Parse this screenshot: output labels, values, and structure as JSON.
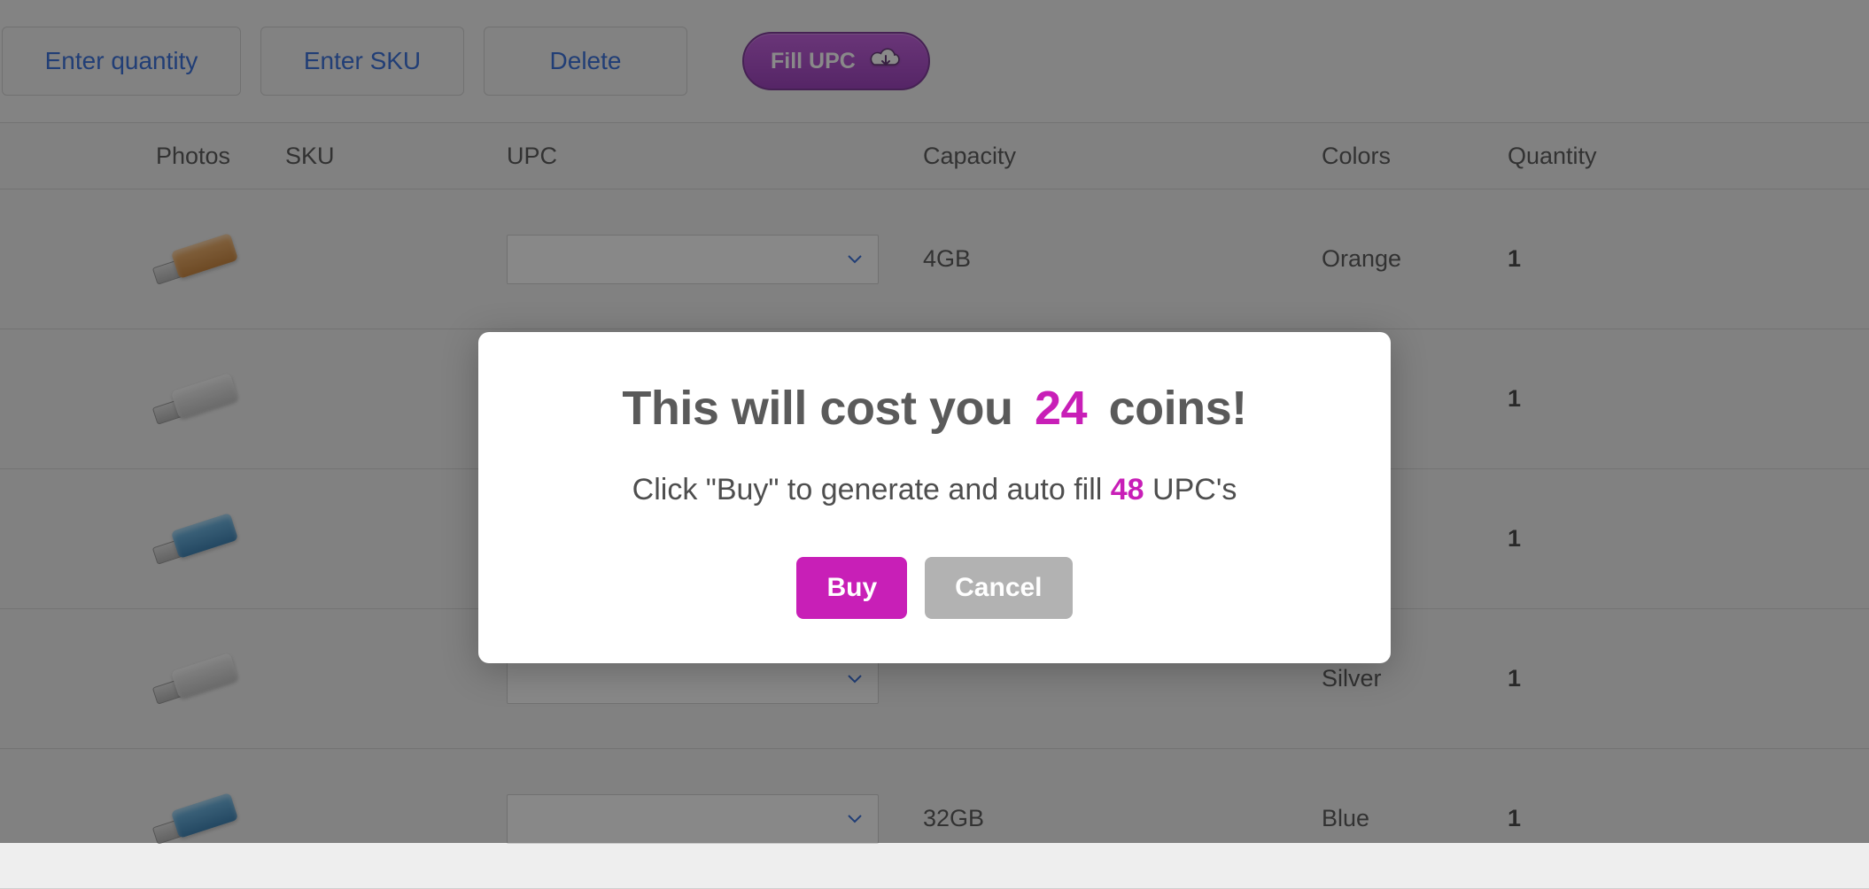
{
  "toolbar": {
    "enter_quantity": "Enter quantity",
    "enter_sku": "Enter SKU",
    "delete": "Delete",
    "fill_upc": "Fill UPC"
  },
  "headers": {
    "photos": "Photos",
    "sku": "SKU",
    "upc": "UPC",
    "capacity": "Capacity",
    "colors": "Colors",
    "quantity": "Quantity"
  },
  "rows": [
    {
      "capacity": "4GB",
      "color": "Orange",
      "quantity": "1",
      "color_class": "c-orange"
    },
    {
      "capacity": "",
      "color": "Silver",
      "quantity": "1",
      "color_class": "c-silver"
    },
    {
      "capacity": "",
      "color": "Blue",
      "quantity": "1",
      "color_class": "c-blue"
    },
    {
      "capacity": "",
      "color": "Silver",
      "quantity": "1",
      "color_class": "c-silver"
    },
    {
      "capacity": "32GB",
      "color": "Blue",
      "quantity": "1",
      "color_class": "c-blue"
    }
  ],
  "modal": {
    "title_pre": "This will cost you ",
    "title_accent": "24",
    "title_post": " coins!",
    "sub_pre": "Click \"Buy\" to generate and auto fill ",
    "sub_accent": "48",
    "sub_post": " UPC's",
    "buy": "Buy",
    "cancel": "Cancel"
  }
}
